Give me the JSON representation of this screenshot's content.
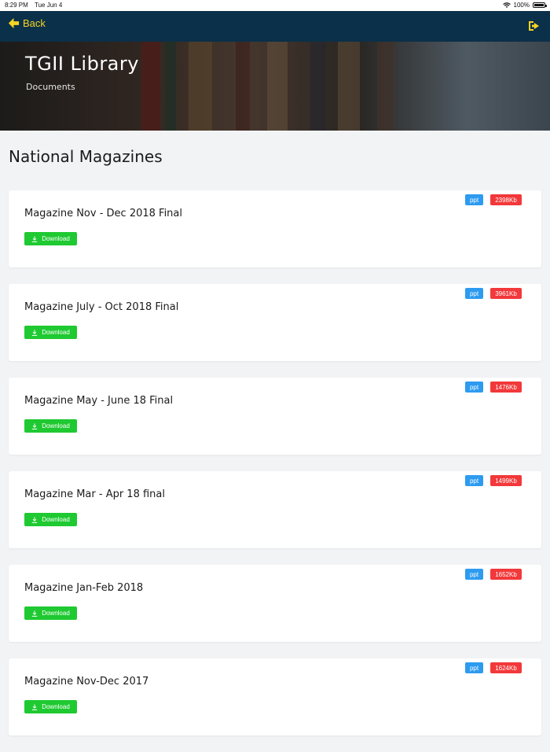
{
  "status_bar": {
    "time": "8:29 PM",
    "date": "Tue Jun 4",
    "battery": "100%",
    "battery_level": 1.0
  },
  "nav": {
    "back_label": "Back",
    "back_icon": "arrow-left-icon",
    "logout_icon": "sign-out-icon",
    "accent_color": "#f5d423",
    "background_color": "#0b3049"
  },
  "hero": {
    "title": "TGII Library",
    "subtitle": "Documents"
  },
  "section": {
    "title": "National Magazines"
  },
  "documents": [
    {
      "title": "Magazine Nov - Dec 2018 Final",
      "type": "ppt",
      "size": "2398Kb",
      "download_label": "Download"
    },
    {
      "title": "Magazine July - Oct 2018 Final",
      "type": "ppt",
      "size": "3961Kb",
      "download_label": "Download"
    },
    {
      "title": "Magazine May - June 18 Final",
      "type": "ppt",
      "size": "1476Kb",
      "download_label": "Download"
    },
    {
      "title": "Magazine Mar - Apr 18 final",
      "type": "ppt",
      "size": "1499Kb",
      "download_label": "Download"
    },
    {
      "title": "Magazine Jan-Feb 2018",
      "type": "ppt",
      "size": "1652Kb",
      "download_label": "Download"
    },
    {
      "title": "Magazine Nov-Dec 2017",
      "type": "ppt",
      "size": "1624Kb",
      "download_label": "Download"
    }
  ],
  "colors": {
    "download": "#1fc931",
    "type_badge": "#2d9bf0",
    "size_badge": "#f2383a"
  }
}
